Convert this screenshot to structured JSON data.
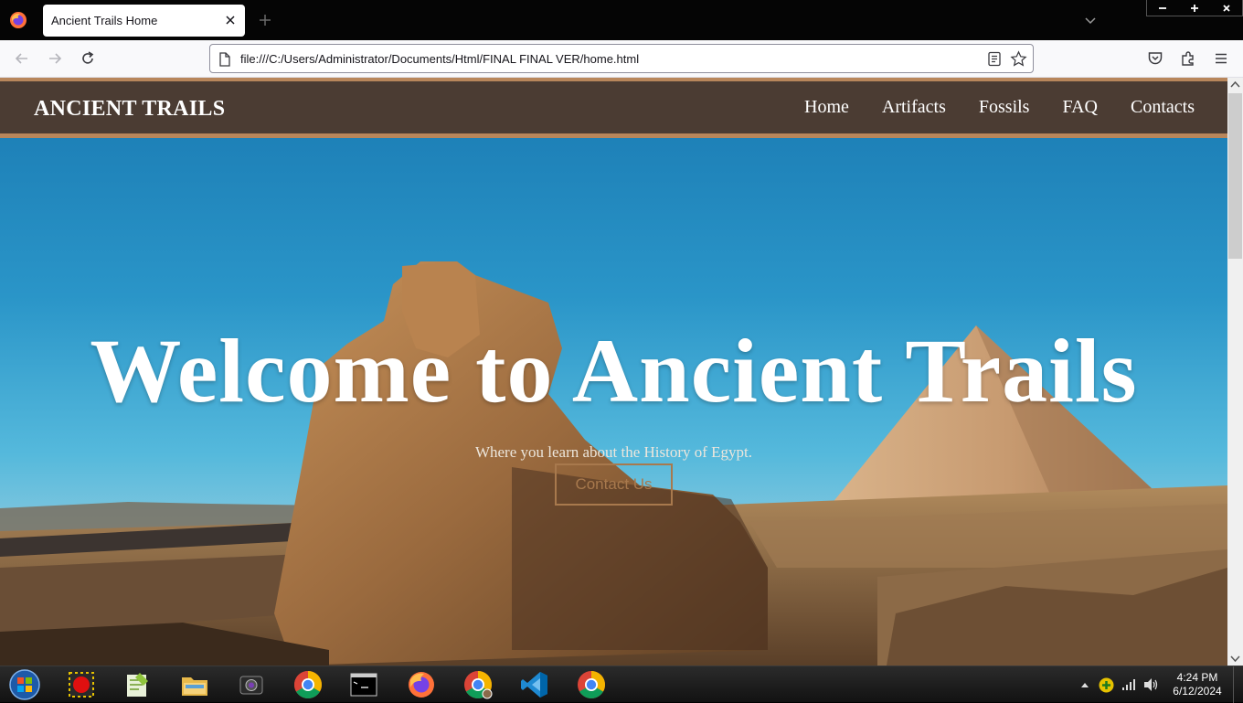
{
  "browser": {
    "tab_title": "Ancient Trails Home",
    "url": "file:///C:/Users/Administrator/Documents/Html/FINAL FINAL VER/home.html",
    "icons": [
      "firefox-icon",
      "close-icon",
      "plus-icon",
      "chevron-down-icon",
      "minimize-icon",
      "maximize-icon",
      "back-icon",
      "forward-icon",
      "reload-icon",
      "page-icon",
      "reader-view-icon",
      "bookmark-star-icon",
      "pocket-icon",
      "extensions-icon",
      "menu-icon"
    ]
  },
  "site": {
    "brand": "ANCIENT TRAILS",
    "nav": [
      "Home",
      "Artifacts",
      "Fossils",
      "FAQ",
      "Contacts"
    ],
    "hero": {
      "title": "Welcome to Ancient Trails",
      "subtitle": "Where you learn about the History of Egypt.",
      "button": "Contact Us"
    },
    "colors": {
      "header_bg": "#4b3c33",
      "header_border": "#b8865b",
      "button_accent": "#a8794d"
    }
  },
  "taskbar": {
    "apps": [
      "start-orb",
      "record-app",
      "notepad-plus-plus",
      "file-explorer",
      "camera-app",
      "chrome",
      "command-prompt",
      "firefox",
      "chrome-profile",
      "vs-code",
      "chrome"
    ],
    "clock": {
      "time": "4:24 PM",
      "date": "6/12/2024"
    }
  }
}
